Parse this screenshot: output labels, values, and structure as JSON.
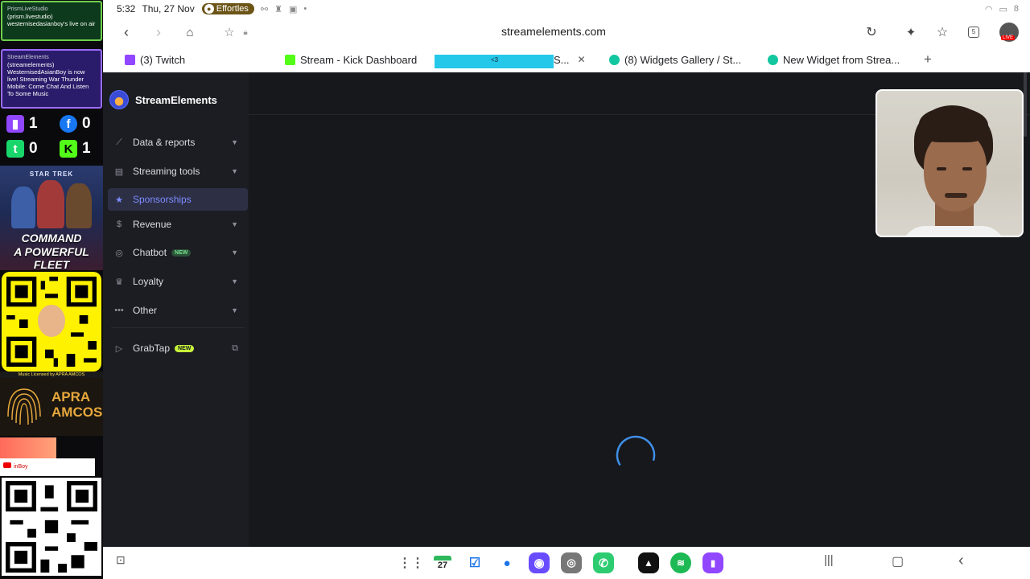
{
  "status_bar": {
    "time": "5:32",
    "date": "Thu, 27 Nov",
    "pill_label": "Effortles",
    "right_badge": "8"
  },
  "browser": {
    "url": "streamelements.com",
    "tab_count": "5",
    "live_badge": "LIVE"
  },
  "tabs": [
    {
      "label": "(3) Twitch",
      "color": "#9146ff"
    },
    {
      "label": "Stream - Kick Dashboard",
      "color": "#53fc18"
    },
    {
      "label": "S...",
      "color": "#3b4bd8"
    },
    {
      "label": "(8) Widgets Gallery / St...",
      "color": "#12c7a0"
    },
    {
      "label": "New Widget from Strea...",
      "color": "#12c7a0"
    }
  ],
  "active_tab_overlay_text": "<3",
  "overlay": {
    "notif1_source": "PrismLiveStudio",
    "notif1_handle": "(prism.livestudio)",
    "notif1_text": "westernisedasianboy's live on air",
    "notif2_source": "StreamElements",
    "notif2_handle": "(streamelements)",
    "notif2_text": "WesternisedAsianBoy is now live! Streaming War Thunder Mobile: Come Chat And Listen To Some Music",
    "counts": {
      "twitch": "1",
      "facebook": "0",
      "trovo": "0",
      "kick": "1"
    },
    "promo_top": "STAR TREK",
    "promo_line1": "COMMAND",
    "promo_line2": "A POWERFUL FLEET",
    "credit": "Music Licensed by APRA AMCOS",
    "apra_line1": "APRA",
    "apra_line2": "AMCOS",
    "yt_text": "inBoy"
  },
  "sidebar": {
    "brand": "StreamElements",
    "items": [
      {
        "label": "Data & reports",
        "icon": "chart-line-icon",
        "chevron": true
      },
      {
        "label": "Streaming tools",
        "icon": "layout-icon",
        "chevron": true
      },
      {
        "label": "Sponsorships",
        "icon": "star-icon",
        "active": true
      },
      {
        "label": "Revenue",
        "icon": "dollar-icon",
        "chevron": true
      },
      {
        "label": "Chatbot",
        "icon": "bot-icon",
        "badge": "NEW",
        "chevron": true
      },
      {
        "label": "Loyalty",
        "icon": "crown-icon",
        "chevron": true
      },
      {
        "label": "Other",
        "icon": "dots-icon",
        "chevron": true
      },
      {
        "label": "GrabTap",
        "icon": "play-icon",
        "badge": "NEW",
        "external": true
      }
    ]
  },
  "taskbar": {
    "calendar_day": "27",
    "apps": [
      "grid-icon",
      "calendar-icon",
      "check-icon",
      "chat-icon",
      "browser-icon",
      "camera-icon",
      "phone-icon",
      "streamer-icon",
      "spotify-icon",
      "twitch-icon"
    ]
  }
}
